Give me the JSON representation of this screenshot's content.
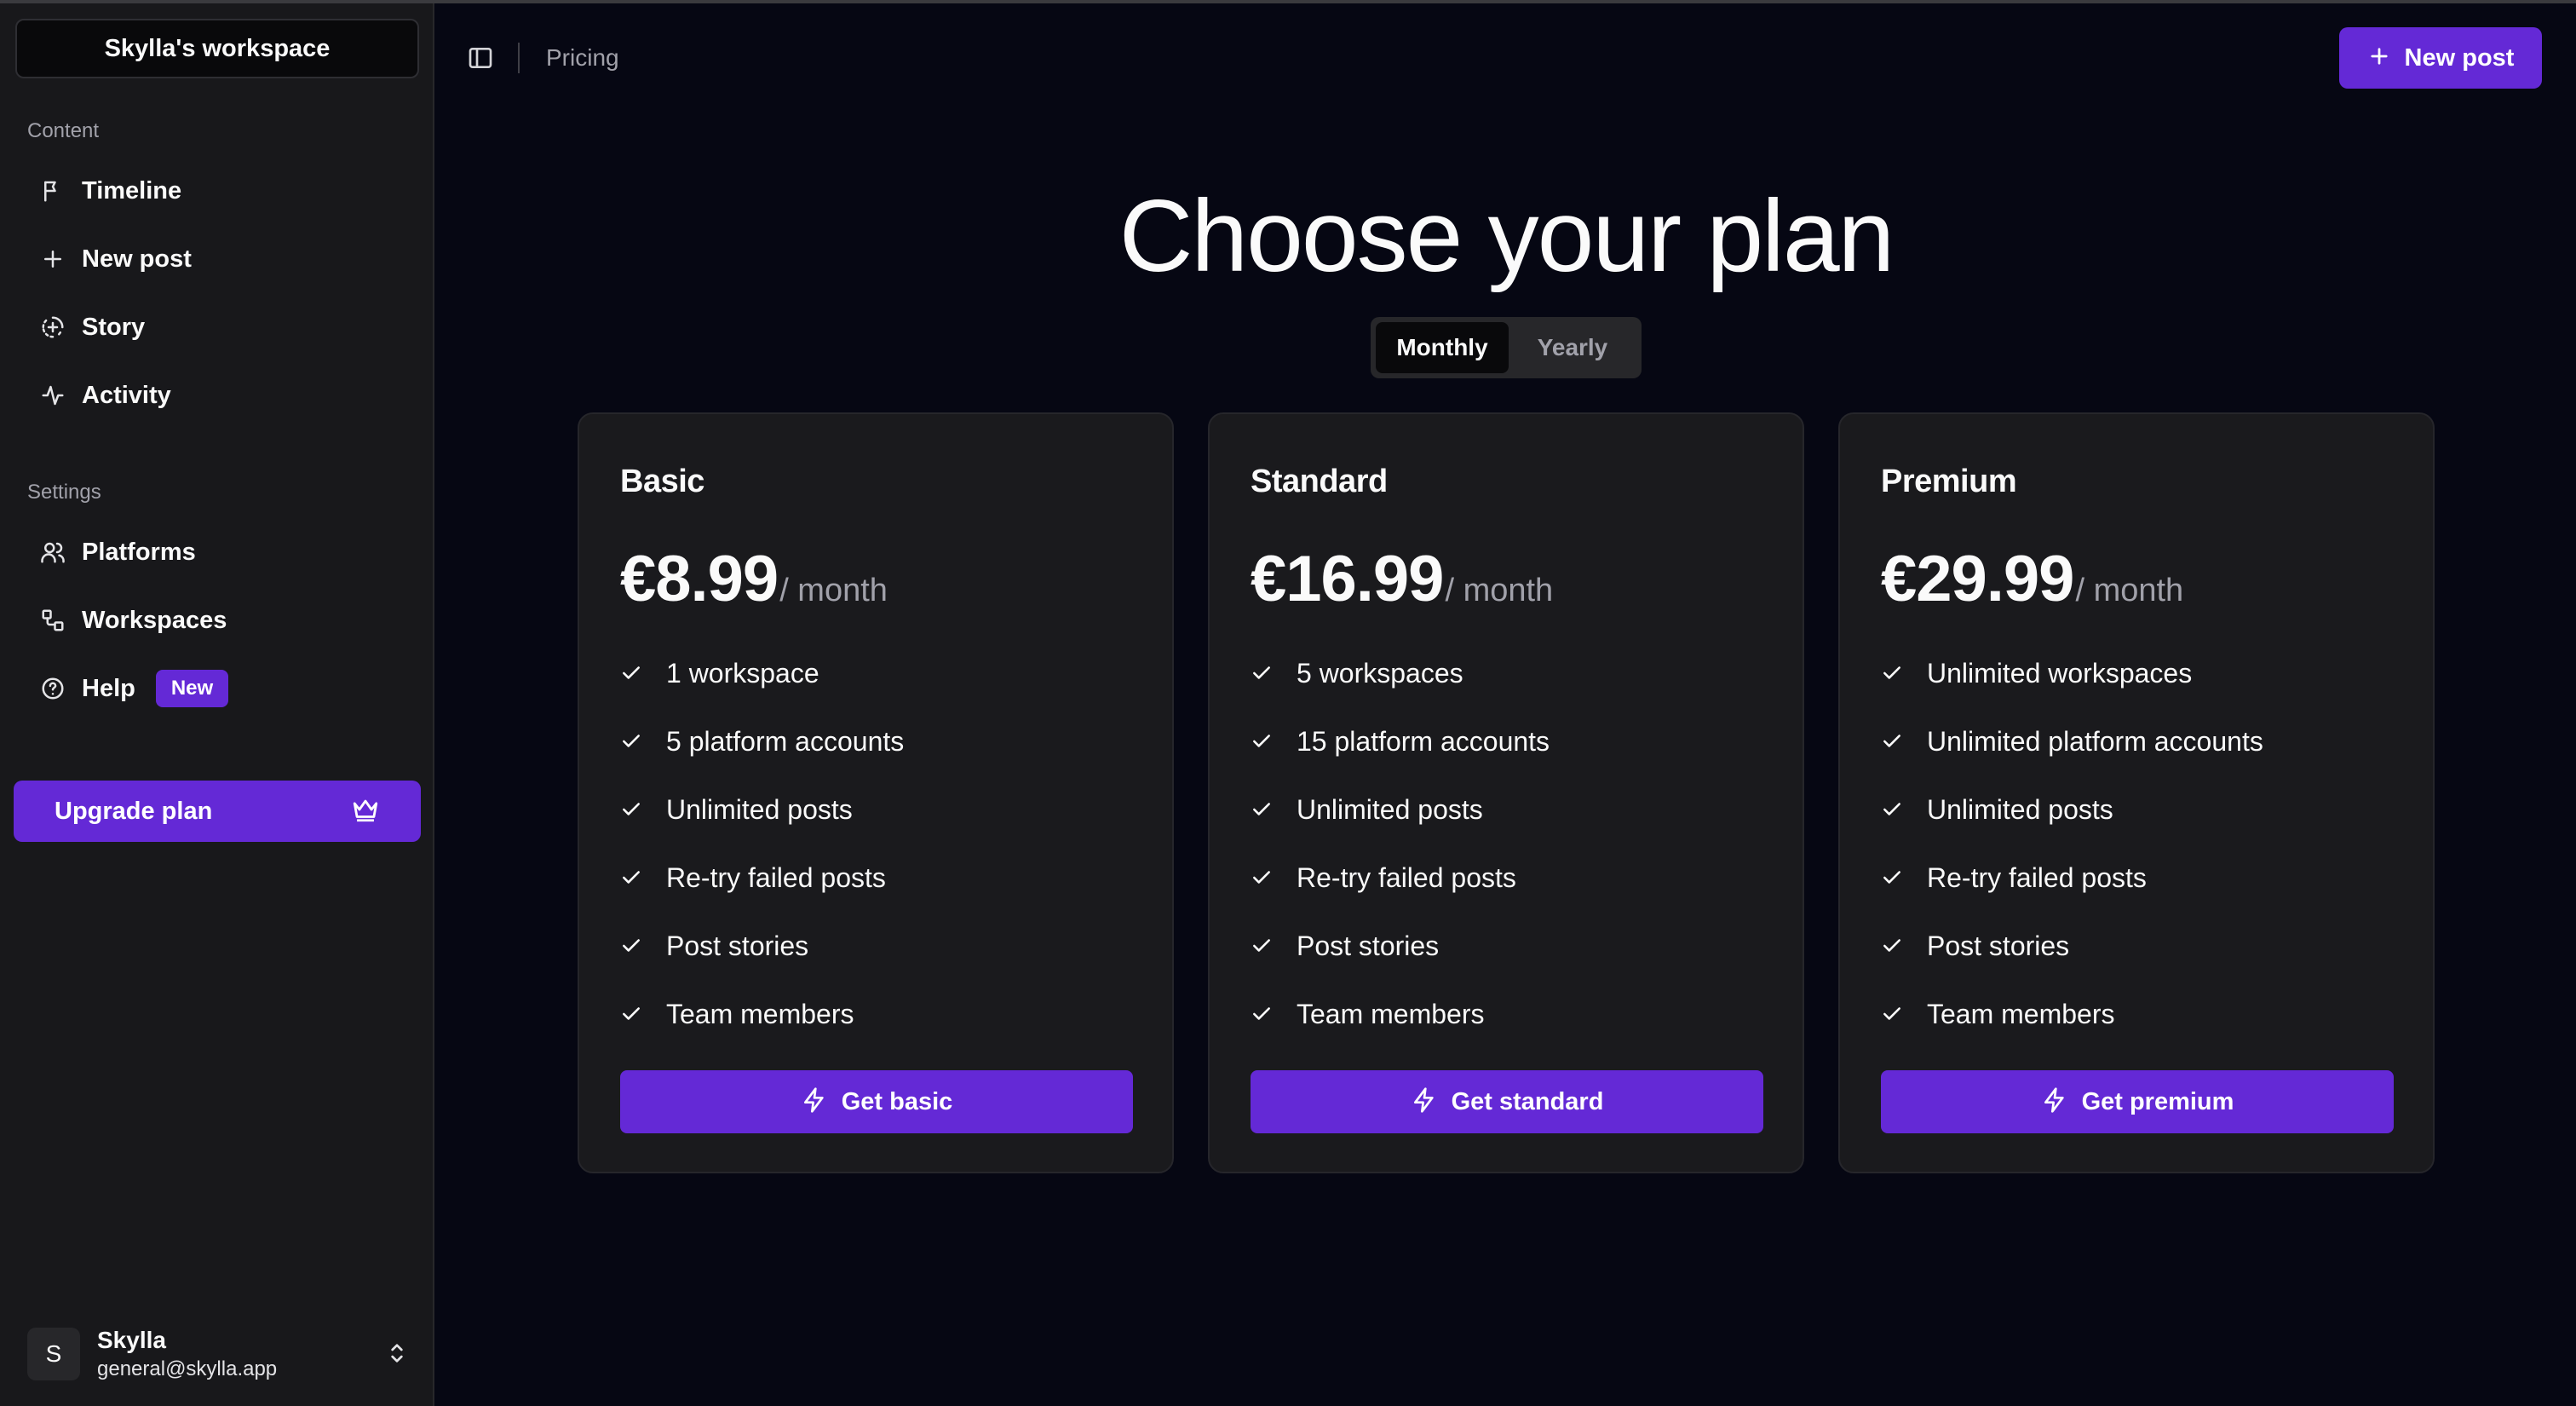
{
  "colors": {
    "accent": "#6429d6",
    "background": "#060713",
    "sidebar": "#18181b",
    "card": "#1a1a1d"
  },
  "sidebar": {
    "workspace_name": "Skylla's workspace",
    "content_label": "Content",
    "content_items": [
      {
        "label": "Timeline",
        "icon": "flag-icon"
      },
      {
        "label": "New post",
        "icon": "plus-icon"
      },
      {
        "label": "Story",
        "icon": "story-circle-icon"
      },
      {
        "label": "Activity",
        "icon": "activity-icon"
      }
    ],
    "settings_label": "Settings",
    "settings_items": [
      {
        "label": "Platforms",
        "icon": "users-icon"
      },
      {
        "label": "Workspaces",
        "icon": "workflow-icon"
      },
      {
        "label": "Help",
        "icon": "help-circle-icon",
        "badge": "New"
      }
    ],
    "upgrade_label": "Upgrade plan",
    "user": {
      "initial": "S",
      "name": "Skylla",
      "email": "general@skylla.app"
    }
  },
  "header": {
    "breadcrumb": "Pricing",
    "new_post_label": "New post"
  },
  "main": {
    "title": "Choose your plan",
    "billing": {
      "options": [
        "Monthly",
        "Yearly"
      ],
      "selected": "Monthly"
    },
    "plans": [
      {
        "name": "Basic",
        "price": "€8.99",
        "period": "/ month",
        "features": [
          "1 workspace",
          "5 platform accounts",
          "Unlimited posts",
          "Re-try failed posts",
          "Post stories",
          "Team members"
        ],
        "cta": "Get basic"
      },
      {
        "name": "Standard",
        "price": "€16.99",
        "period": "/ month",
        "features": [
          "5 workspaces",
          "15 platform accounts",
          "Unlimited posts",
          "Re-try failed posts",
          "Post stories",
          "Team members"
        ],
        "cta": "Get standard"
      },
      {
        "name": "Premium",
        "price": "€29.99",
        "period": "/ month",
        "features": [
          "Unlimited workspaces",
          "Unlimited platform accounts",
          "Unlimited posts",
          "Re-try failed posts",
          "Post stories",
          "Team members"
        ],
        "cta": "Get premium"
      }
    ]
  }
}
